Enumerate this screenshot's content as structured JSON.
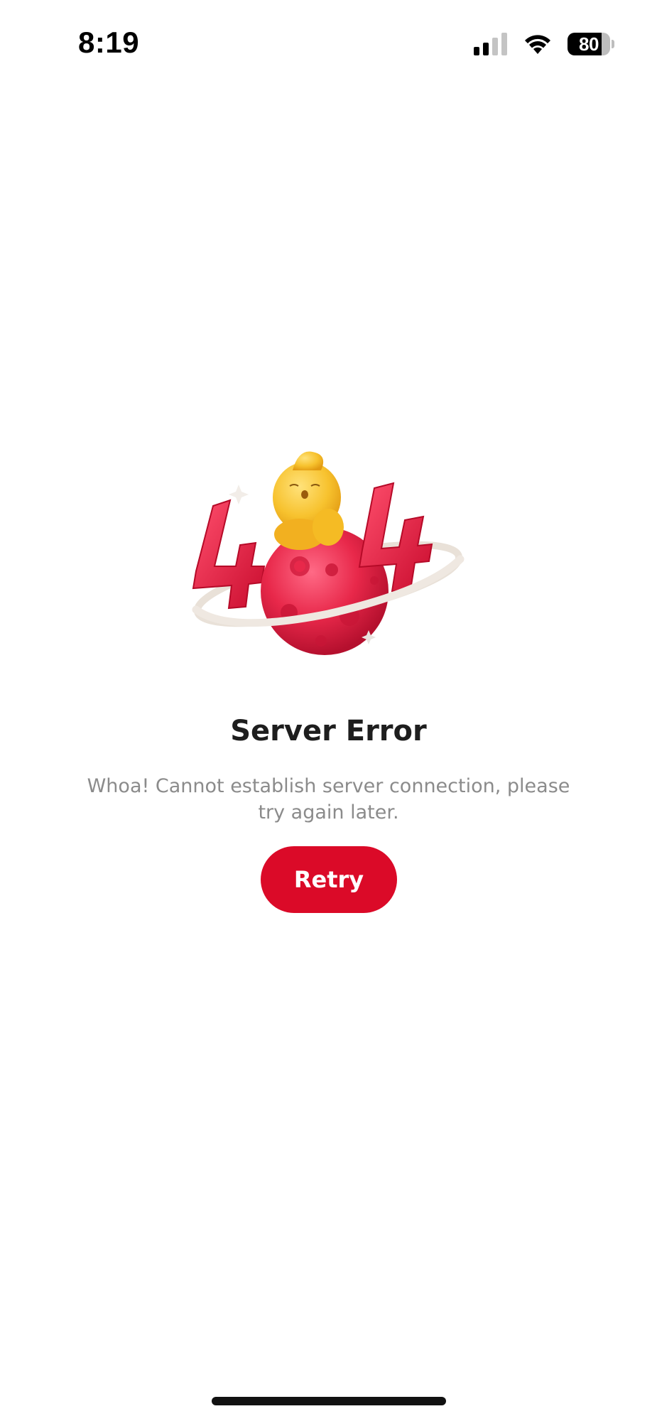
{
  "status_bar": {
    "time": "8:19",
    "battery_level": "80",
    "signal_bars_filled": 2,
    "signal_bars_total": 4,
    "icons": [
      "cellular-signal-icon",
      "wifi-icon",
      "battery-icon"
    ]
  },
  "illustration": {
    "digits": [
      "4",
      "4"
    ],
    "description_icon": "error-404-planet-illustration",
    "colors": {
      "planet": "#e8284a",
      "digits": "#e2163b",
      "ring": "#efe8e1",
      "character": "#f7c22e"
    }
  },
  "error": {
    "title": "Server Error",
    "message": "Whoa! Cannot establish server connection, please try again later."
  },
  "retry_button": {
    "label": "Retry",
    "color": "#db0a28"
  }
}
